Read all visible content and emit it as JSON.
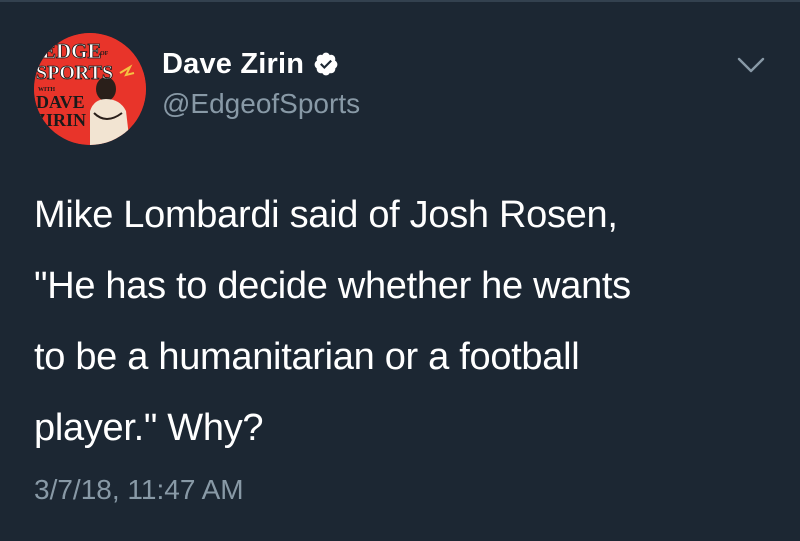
{
  "tweet": {
    "author": {
      "display_name": "Dave Zirin",
      "handle": "@EdgeofSports",
      "verified": true,
      "avatar_text": {
        "line1": "EDGE",
        "of": "OF",
        "line2": "SPORTS",
        "with": "WITH",
        "line3": "DAVE",
        "line4": "ZIRIN"
      }
    },
    "text_lines": [
      "Mike Lombardi said of Josh Rosen,",
      "\"He has to decide whether he wants",
      "to be a humanitarian or a football",
      "player.\" Why?"
    ],
    "timestamp": "3/7/18, 11:47 AM"
  },
  "icons": {
    "verified": "verified-badge-icon",
    "menu": "chevron-down-icon"
  },
  "colors": {
    "background": "#1c2733",
    "text_primary": "#ffffff",
    "text_secondary": "#8899a6",
    "avatar_red": "#e8342a"
  }
}
